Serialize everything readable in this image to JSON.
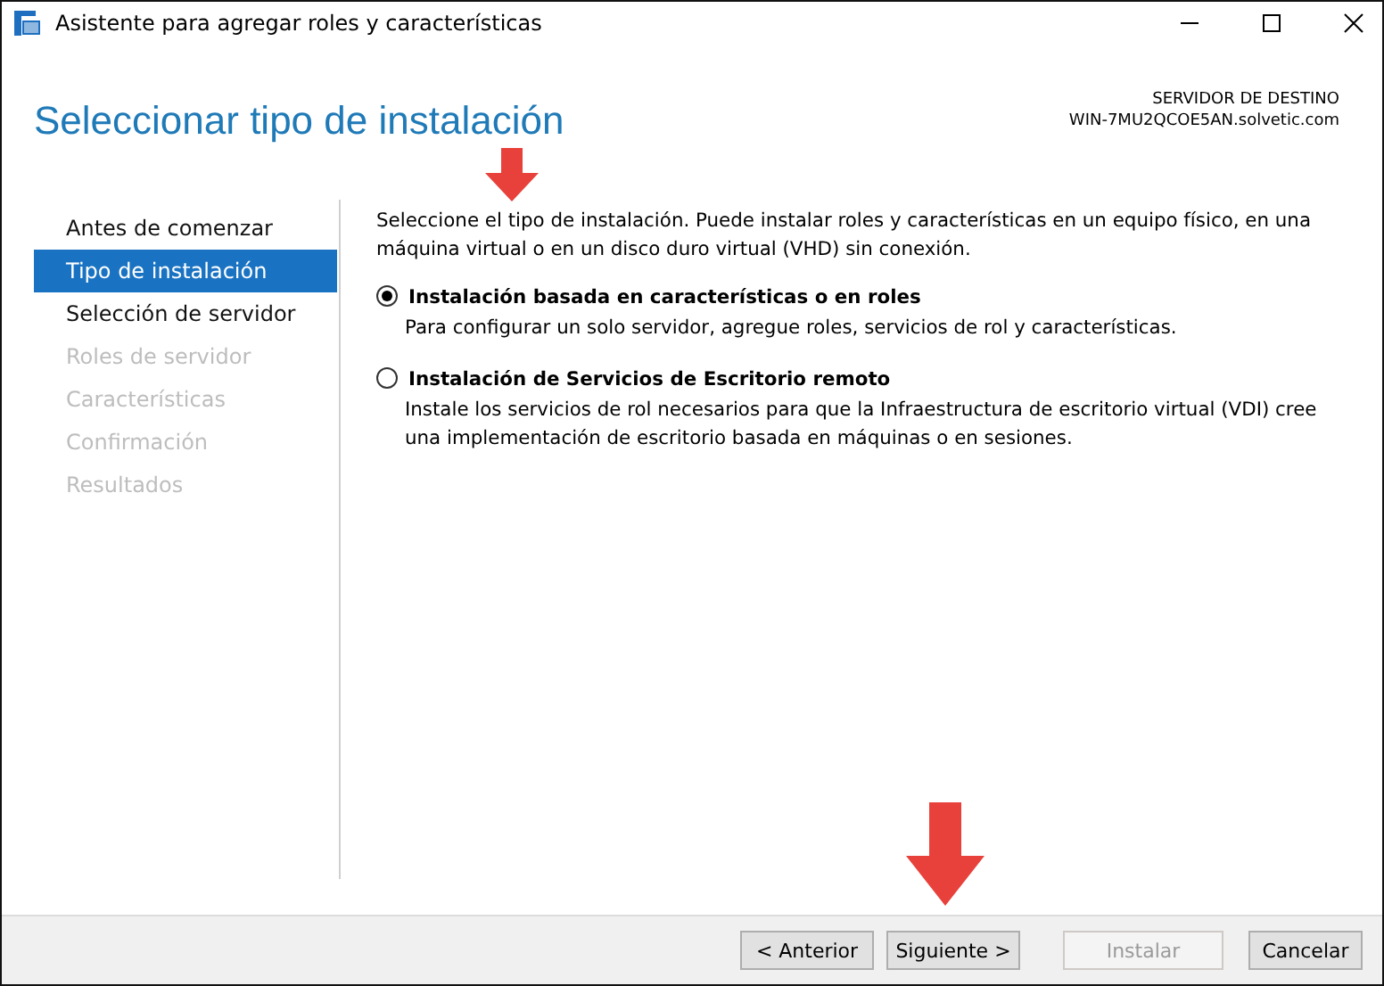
{
  "window": {
    "title": "Asistente para agregar roles y características"
  },
  "header": {
    "title": "Seleccionar tipo de instalación",
    "server_label": "SERVIDOR DE DESTINO",
    "server_name": "WIN-7MU2QCOE5AN.solvetic.com"
  },
  "sidebar": {
    "items": [
      {
        "label": "Antes de comenzar",
        "selected": false,
        "disabled": false
      },
      {
        "label": "Tipo de instalación",
        "selected": true,
        "disabled": false
      },
      {
        "label": "Selección de servidor",
        "selected": false,
        "disabled": false
      },
      {
        "label": "Roles de servidor",
        "selected": false,
        "disabled": true
      },
      {
        "label": "Características",
        "selected": false,
        "disabled": true
      },
      {
        "label": "Confirmación",
        "selected": false,
        "disabled": true
      },
      {
        "label": "Resultados",
        "selected": false,
        "disabled": true
      }
    ]
  },
  "content": {
    "intro": "Seleccione el tipo de instalación. Puede instalar roles y características en un equipo físico, en una máquina virtual o en un disco duro virtual (VHD) sin conexión.",
    "options": [
      {
        "label": "Instalación basada en características o en roles",
        "description": "Para configurar un solo servidor, agregue roles, servicios de rol y características.",
        "selected": true
      },
      {
        "label": "Instalación de Servicios de Escritorio remoto",
        "description": "Instale los servicios de rol necesarios para que la Infraestructura de escritorio virtual (VDI) cree una implementación de escritorio basada en máquinas o en sesiones.",
        "selected": false
      }
    ]
  },
  "buttons": [
    {
      "label": "< Anterior",
      "disabled": false
    },
    {
      "label": "Siguiente >",
      "disabled": false
    },
    {
      "label": "Instalar",
      "disabled": true
    },
    {
      "label": "Cancelar",
      "disabled": false
    }
  ]
}
